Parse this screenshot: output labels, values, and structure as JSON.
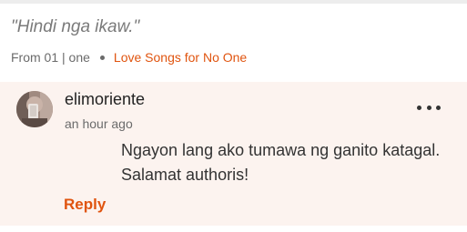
{
  "quote": {
    "text": "\"Hindi nga ikaw.\""
  },
  "source": {
    "chapter": "From 01 | one",
    "story": "Love Songs for No One"
  },
  "comment": {
    "username": "elimoriente",
    "timestamp": "an hour ago",
    "lines": [
      "Ngayon lang ako tumawa ng ganito katagal.",
      "Salamat authoris!"
    ],
    "reply_label": "Reply",
    "more_icon": "more-options-icon"
  },
  "colors": {
    "accent": "#e0540f",
    "comment_background": "#fcf3ef",
    "muted_text": "#6b6b6b"
  }
}
